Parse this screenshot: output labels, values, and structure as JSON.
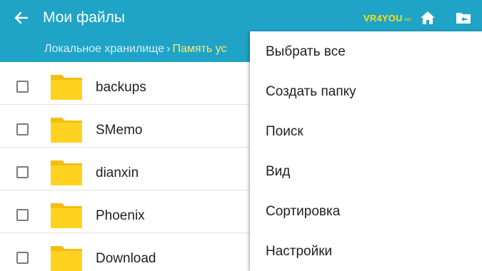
{
  "header": {
    "title": "Мои файлы",
    "back_icon": "arrow-left-icon",
    "home_icon": "home-icon",
    "folder_up_icon": "folder-up-icon",
    "background_color": "#1fa4c7"
  },
  "watermark": {
    "text": "VR4YOU",
    "suffix": ".net"
  },
  "breadcrumb": {
    "root": "Локальное хранилище",
    "separator": "›",
    "current": "Память ус"
  },
  "files": [
    {
      "name": "backups",
      "type": "folder",
      "checked": false
    },
    {
      "name": "SMemo",
      "type": "folder",
      "checked": false
    },
    {
      "name": "dianxin",
      "type": "folder",
      "checked": false
    },
    {
      "name": "Phoenix",
      "type": "folder",
      "checked": false
    },
    {
      "name": "Download",
      "type": "folder",
      "checked": false
    }
  ],
  "menu": {
    "items": [
      {
        "label": "Выбрать все"
      },
      {
        "label": "Создать папку"
      },
      {
        "label": "Поиск"
      },
      {
        "label": "Вид"
      },
      {
        "label": "Сортировка"
      },
      {
        "label": "Настройки"
      }
    ]
  },
  "colors": {
    "accent": "#1fa4c7",
    "breadcrumb_current": "#fbe96a",
    "folder": "#ffd21f",
    "folder_tab": "#f4bd14"
  }
}
